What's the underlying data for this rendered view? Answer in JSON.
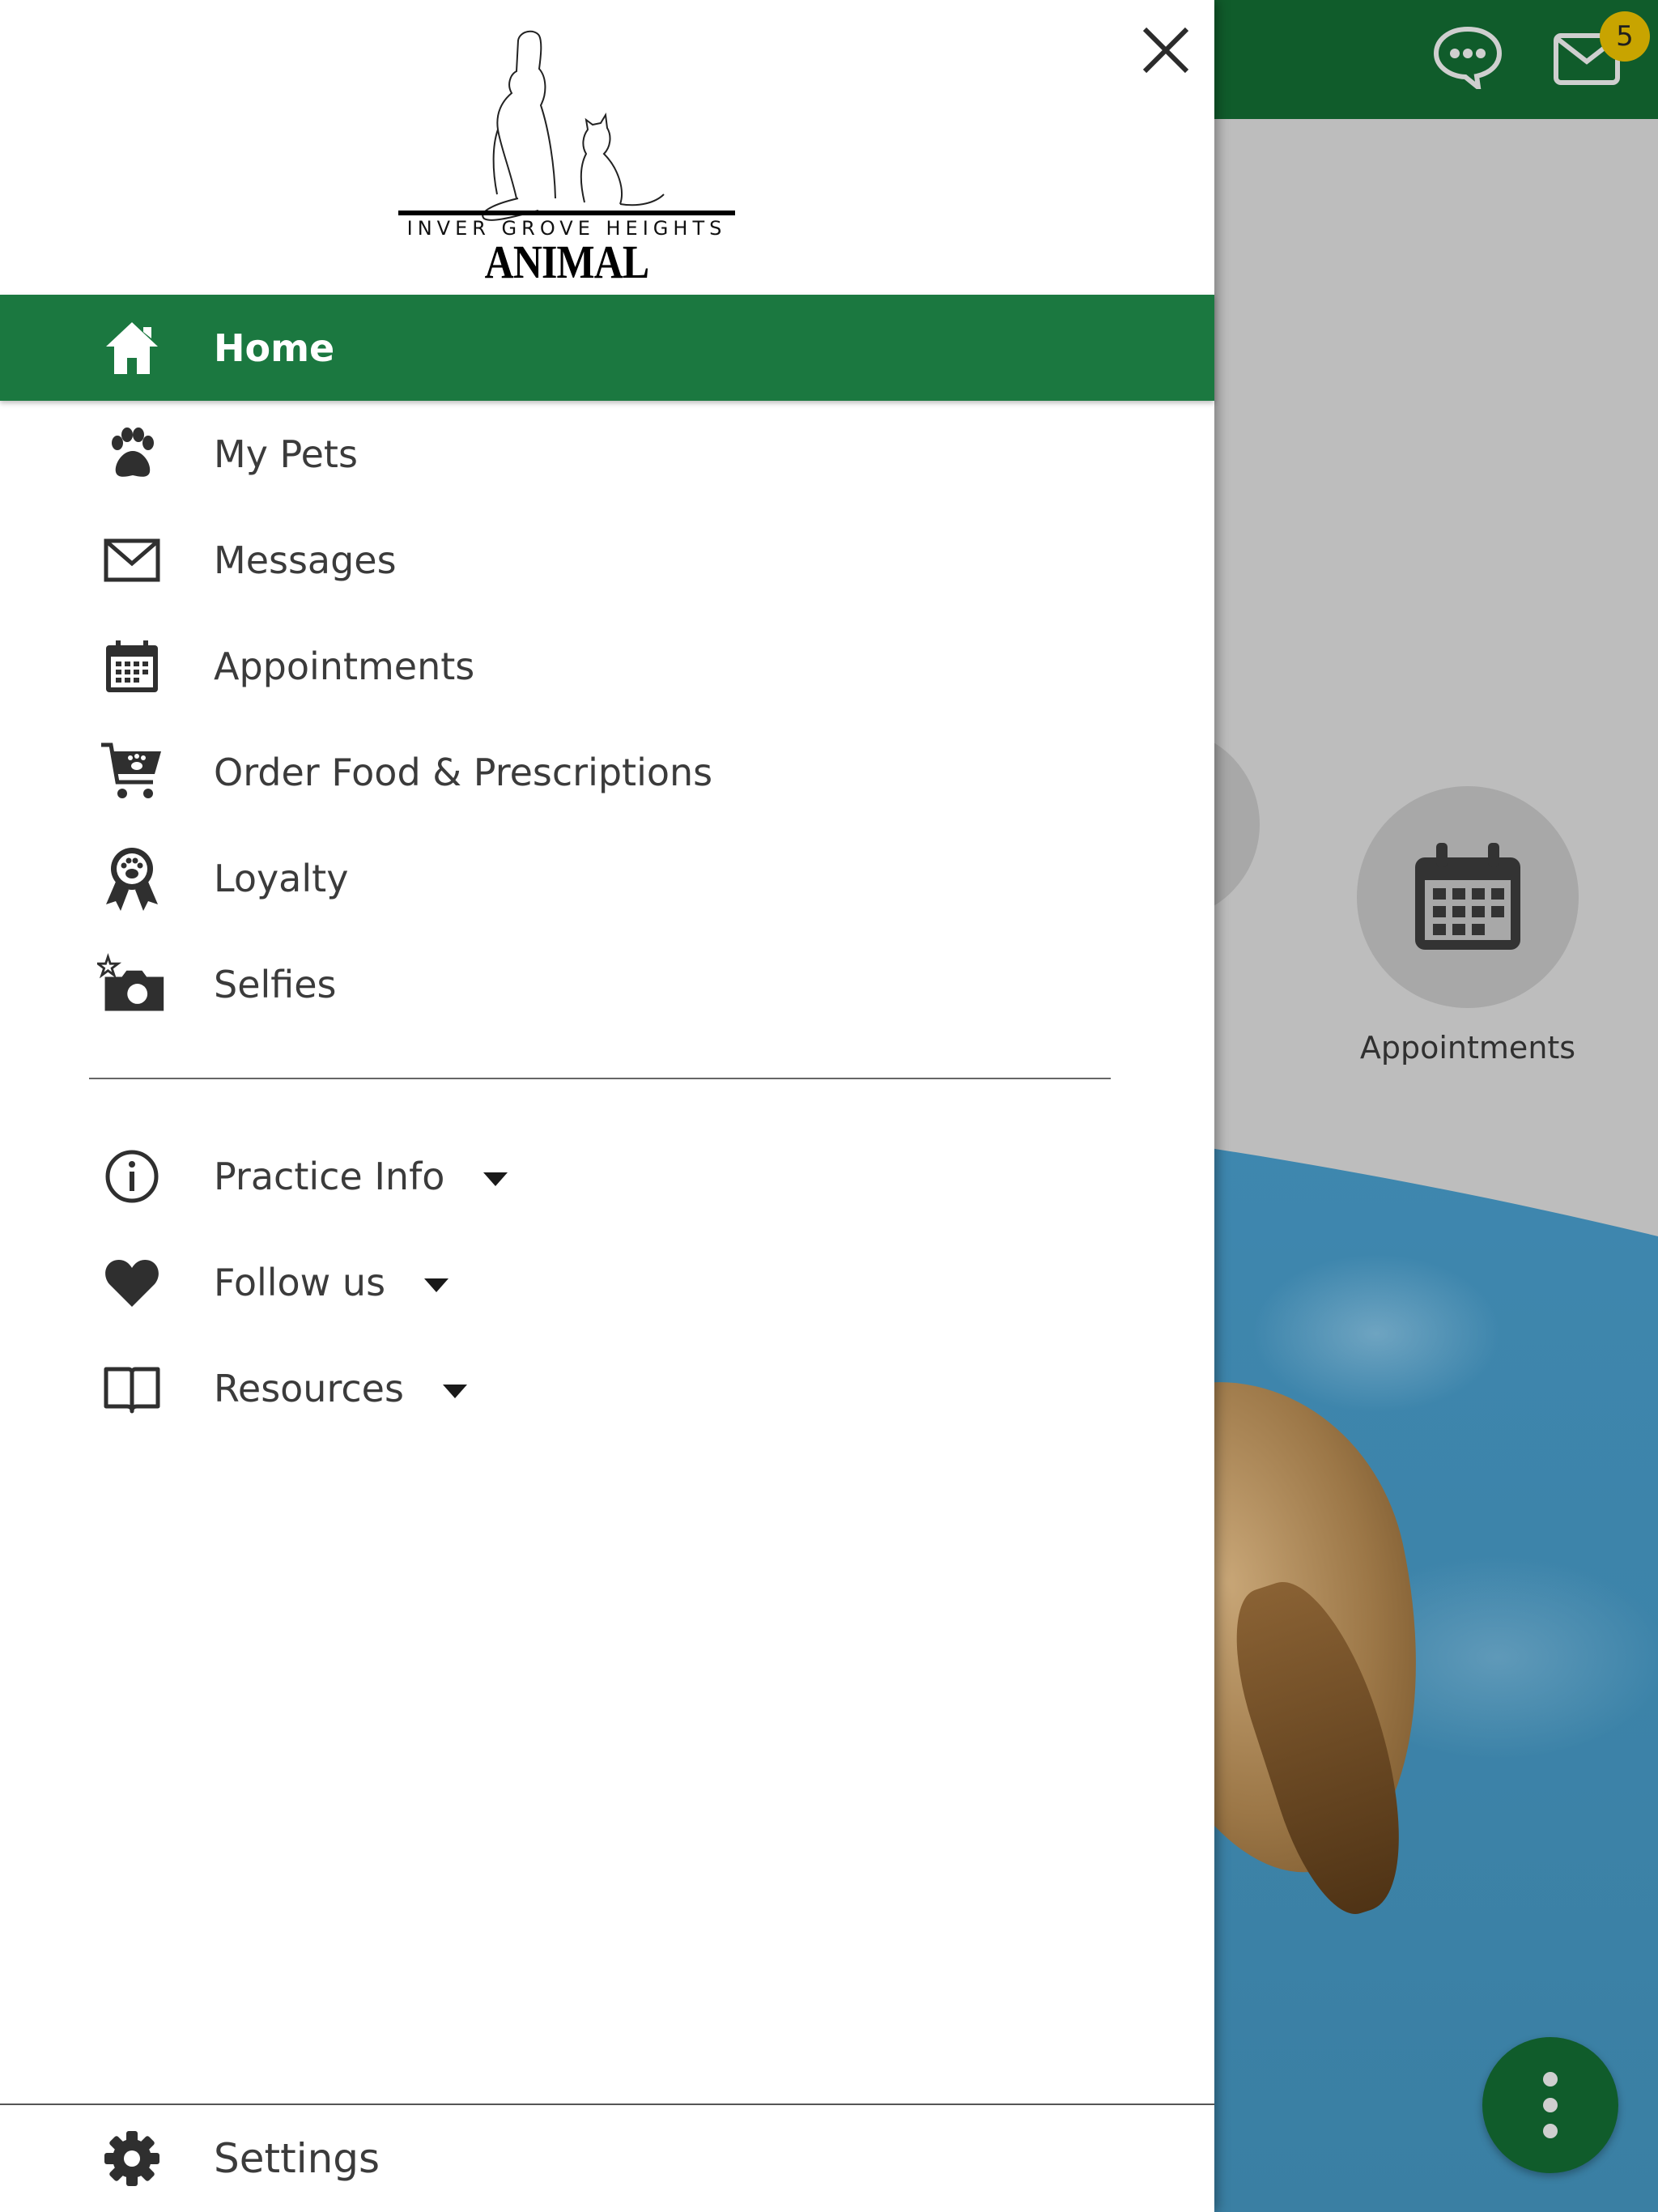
{
  "header": {
    "message_badge": "5"
  },
  "background": {
    "appointments_label": "Appointments"
  },
  "drawer": {
    "logo": {
      "line1": "INVER GROVE HEIGHTS",
      "line2": "ANIMAL HOSPITAL"
    },
    "items": [
      {
        "label": "Home",
        "icon": "home-icon",
        "active": true
      },
      {
        "label": "My Pets",
        "icon": "paw-icon"
      },
      {
        "label": "Messages",
        "icon": "envelope-icon"
      },
      {
        "label": "Appointments",
        "icon": "calendar-icon"
      },
      {
        "label": "Order Food & Prescriptions",
        "icon": "cart-icon"
      },
      {
        "label": "Loyalty",
        "icon": "ribbon-icon"
      },
      {
        "label": "Selfies",
        "icon": "camera-icon"
      }
    ],
    "expandable": [
      {
        "label": "Practice Info",
        "icon": "info-icon"
      },
      {
        "label": "Follow us",
        "icon": "heart-icon"
      },
      {
        "label": "Resources",
        "icon": "book-icon"
      }
    ],
    "settings_label": "Settings"
  },
  "colors": {
    "primary": "#105c2b",
    "active_item": "#1b7840",
    "badge": "#c8a400"
  }
}
